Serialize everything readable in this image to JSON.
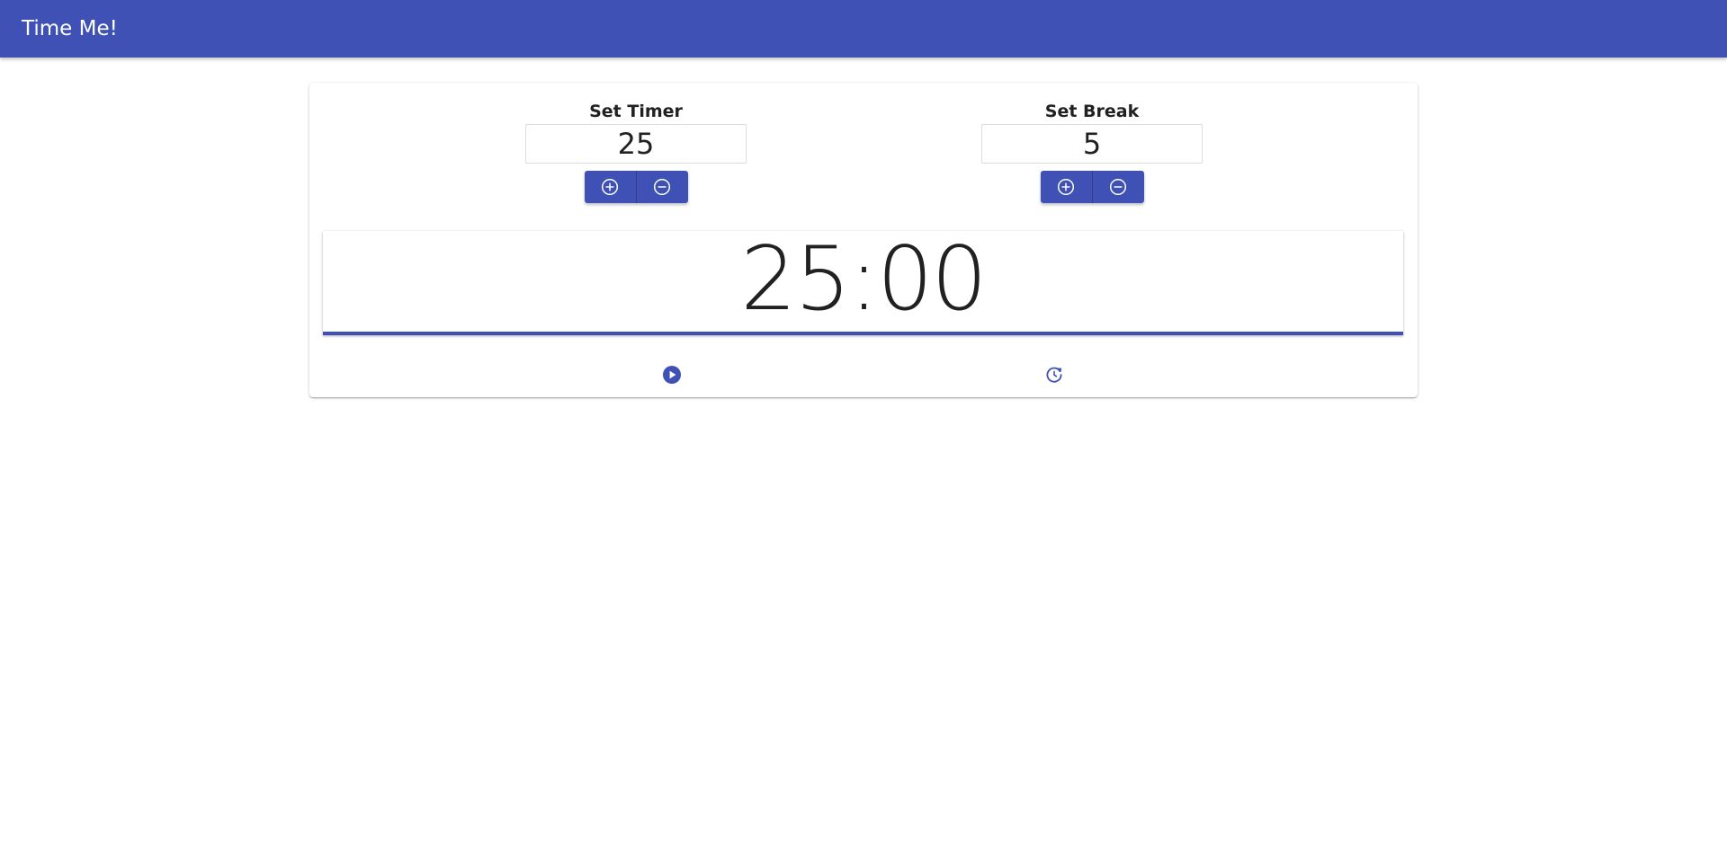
{
  "app": {
    "title": "Time Me!"
  },
  "timer_setting": {
    "label": "Set Timer",
    "value": "25",
    "increment_icon": "plus-circle-icon",
    "decrement_icon": "minus-circle-icon"
  },
  "break_setting": {
    "label": "Set Break",
    "value": "5",
    "increment_icon": "plus-circle-icon",
    "decrement_icon": "minus-circle-icon"
  },
  "clock": {
    "display": "25:00"
  },
  "controls": {
    "start_icon": "play-circle-icon",
    "reset_icon": "restart-icon"
  },
  "colors": {
    "primary": "#3f51b5",
    "text": "#212121",
    "background": "#ffffff"
  }
}
